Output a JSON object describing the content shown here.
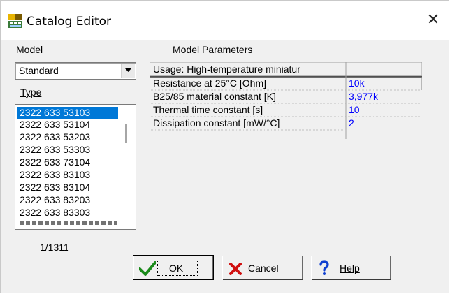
{
  "window": {
    "title": "Catalog Editor",
    "close_glyph": "✕"
  },
  "model": {
    "label": "Model",
    "selected": "Standard"
  },
  "type": {
    "label": "Type",
    "items": [
      "2322 633 53103",
      "2322 633 53104",
      "2322 633 53203",
      "2322 633 53303",
      "2322 633 73104",
      "2322 633 83103",
      "2322 633 83104",
      "2322 633 83203",
      "2322 633 83303"
    ],
    "selected_index": 0,
    "position_text": "1/1311"
  },
  "parameters": {
    "label": "Model Parameters",
    "usage": "Usage: High-temperature miniatur",
    "rows": [
      {
        "name": "Resistance at 25°C [Ohm]",
        "value": "10k"
      },
      {
        "name": "B25/85 material constant [K]",
        "value": "3,977k"
      },
      {
        "name": "Thermal time constant [s]",
        "value": "10"
      },
      {
        "name": "Dissipation constant [mW/°C]",
        "value": "2"
      }
    ],
    "value_color": "#0000ff"
  },
  "buttons": {
    "ok": "OK",
    "cancel": "Cancel",
    "help": "Help"
  },
  "icons": {
    "app": "catalog-editor-icon",
    "ok": "checkmark-icon",
    "cancel": "red-x-icon",
    "help": "blue-question-icon"
  }
}
